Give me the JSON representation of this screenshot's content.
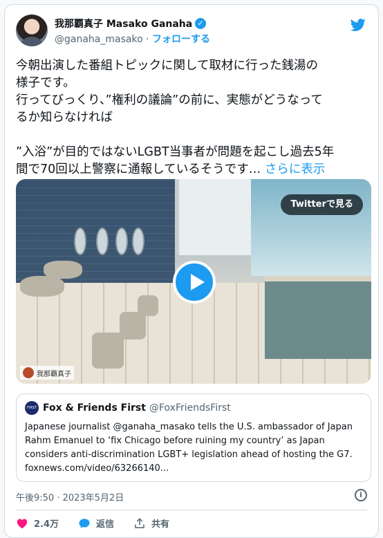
{
  "author": {
    "name": "我那覇真子 Masako Ganaha",
    "handle": "@ganaha_masako",
    "separator": "·",
    "follow_label": "フォローする"
  },
  "tweet": {
    "lines_p1": [
      "今朝出演した番組トピックに関して取材に行った銭湯の",
      "様子です。",
      "行ってびっくり、”権利の議論”の前に、実態がどうなって",
      "るか知らなければ"
    ],
    "lines_p2": [
      "”入浴”が目的ではないLGBT当事者が問題を起こし過去5年",
      "間で70回以上警察に通報しているそうです…"
    ],
    "show_more": "さらに表示"
  },
  "media": {
    "watch_label": "Twitterで見る",
    "watermark": "我那覇真子"
  },
  "quote": {
    "avatar_text": "FIRST",
    "name": "Fox & Friends First",
    "handle": "@FoxFriendsFirst",
    "lines": [
      "Japanese journalist @ganaha_masako tells the U.S. ambassador of Japan",
      "Rahm Emanuel to ‘fix Chicago before ruining my country’ as Japan",
      "considers anti-discrimination LGBT+ legislation ahead of hosting the G7.",
      "foxnews.com/video/63266140..."
    ]
  },
  "meta": {
    "timestamp": "午後9:50 · 2023年5月2日",
    "info_glyph": "i"
  },
  "actions": {
    "like_count": "2.4万",
    "reply_label": "返信",
    "share_label": "共有"
  },
  "colors": {
    "accent": "#1d9bf0",
    "like": "#f91880",
    "text_secondary": "#536471",
    "border": "#cfd9de"
  },
  "icons": [
    "verified-badge-icon",
    "twitter-bird-icon",
    "play-icon",
    "info-icon",
    "heart-icon",
    "reply-bubble-icon",
    "share-icon"
  ]
}
